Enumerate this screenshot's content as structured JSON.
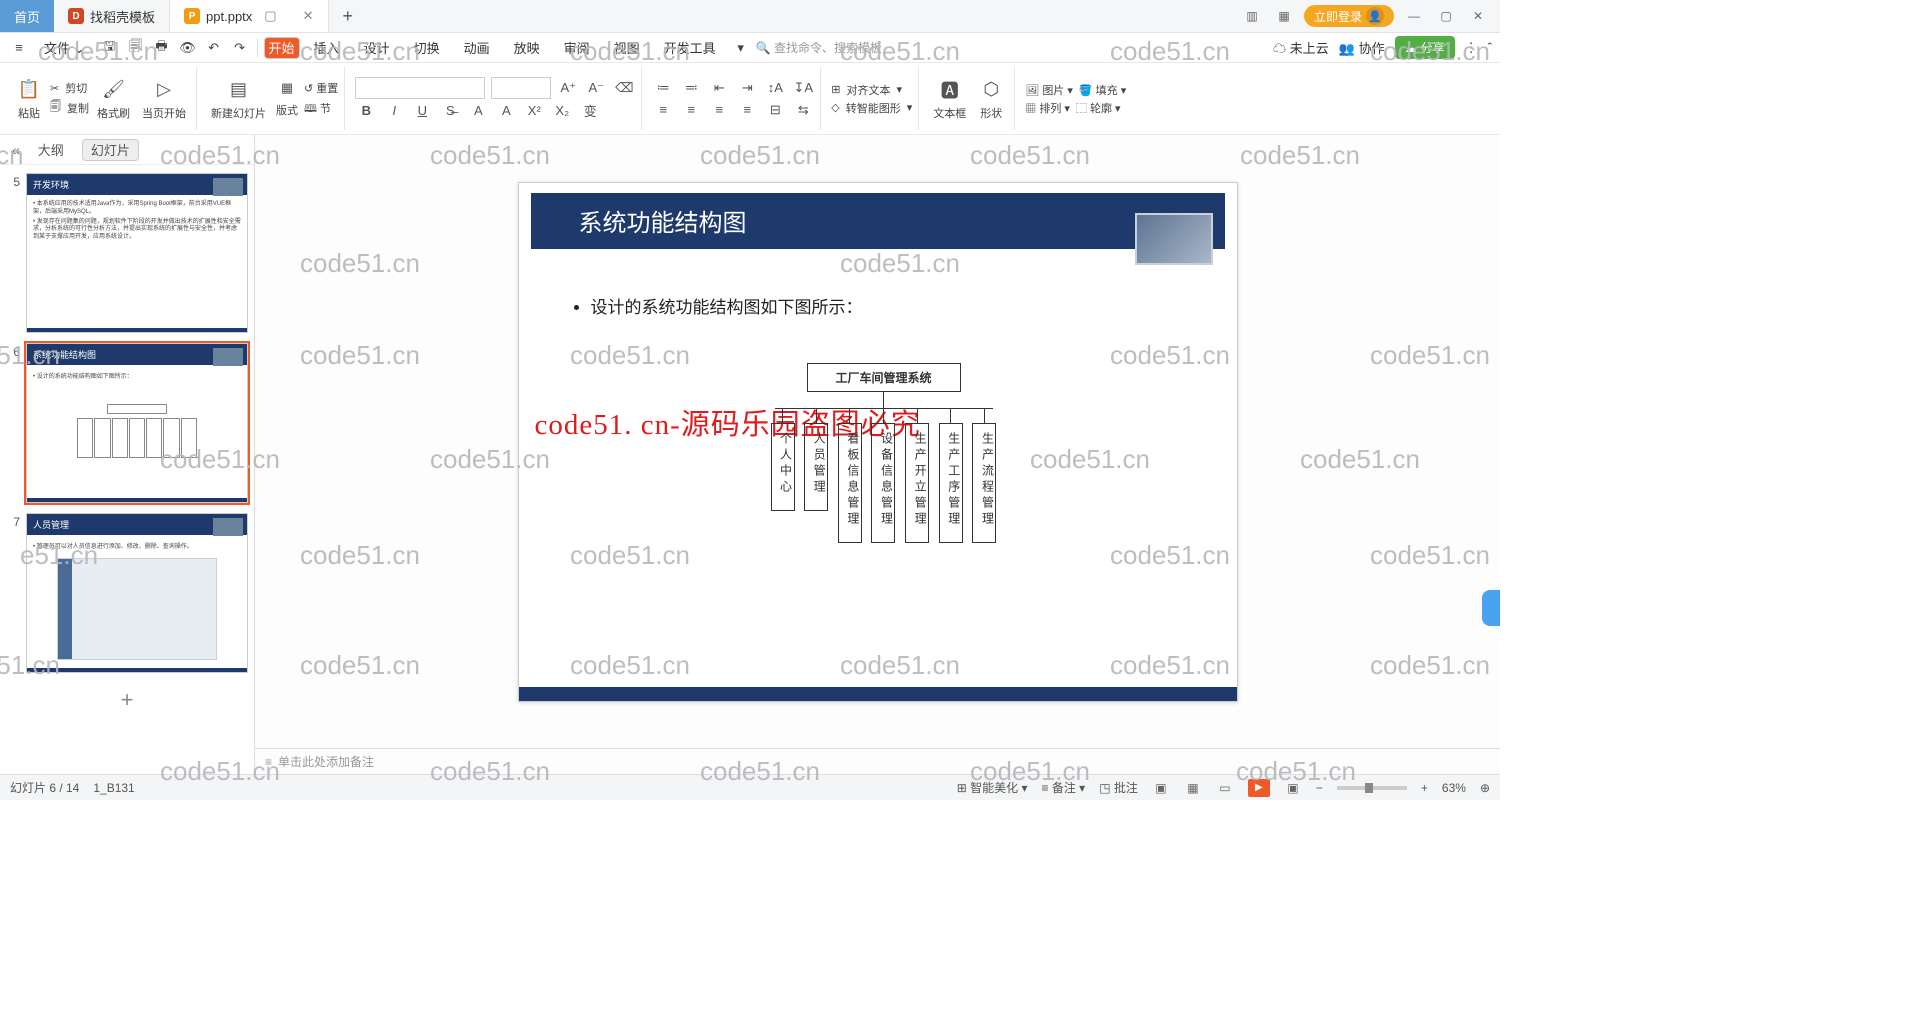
{
  "tabs": {
    "home": "首页",
    "t1": "找稻壳模板",
    "t2": "ppt.pptx"
  },
  "login": "立即登录",
  "menu": {
    "file": "文件",
    "start": "开始",
    "insert": "插入",
    "design": "设计",
    "switch": "切换",
    "anim": "动画",
    "show": "放映",
    "review": "审阅",
    "view": "视图",
    "dev": "开发工具",
    "search": "查找命令、搜索模板",
    "cloud": "未上云",
    "collab": "协作",
    "share": "分享"
  },
  "ribbon": {
    "paste": "粘贴",
    "cut": "剪切",
    "copy": "复制",
    "fmt": "格式刷",
    "curpage": "当页开始",
    "newslide": "新建幻灯片",
    "layout": "版式",
    "section": "节",
    "reset": "重置",
    "align": "对齐文本",
    "toshape": "转智能图形",
    "textbox": "文本框",
    "shape": "形状",
    "pic": "图片",
    "arrange": "排列",
    "fill": "填充",
    "outline": "轮廓"
  },
  "left": {
    "outline": "大纲",
    "slides": "幻灯片"
  },
  "thumbs": {
    "n5": "5",
    "n6": "6",
    "n7": "7",
    "t5": "开发环境",
    "t6": "系统功能结构图",
    "t7": "人员管理",
    "b5a": "• 本系统应用的技术适用Java作为，采用Spring Boot框架，前台采用VUE框架，后端采用MySQL。",
    "b5b": "• 发现存在问题集的问题，规划软件下阶段的开发并做出技术的扩展性和安全需求，分析系统的可行性分析方法，并提出实现系统的扩展性与安全性，并考虑到某于支撑应用开发，应用系统设计。",
    "b6": "• 设计的系统功能结构图如下图所示：",
    "b7": "• 管理员可以对人员信息进行添加、修改、删除、查询操作。"
  },
  "slide": {
    "title": "系统功能结构图",
    "bullet": "设计的系统功能结构图如下图所示：",
    "overlay": "code51. cn-源码乐园盗图必究",
    "org_top": "工厂车间管理系统",
    "org": [
      "个人中心",
      "人员管理",
      "看板信息管理",
      "设备信息管理",
      "生产开立管理",
      "生产工序管理",
      "生产流程管理"
    ]
  },
  "notes": "单击此处添加备注",
  "status": {
    "pg": "幻灯片 6 / 14",
    "file": "1_B131",
    "beautify": "智能美化",
    "note": "备注",
    "comment": "批注",
    "zoom": "63%"
  }
}
